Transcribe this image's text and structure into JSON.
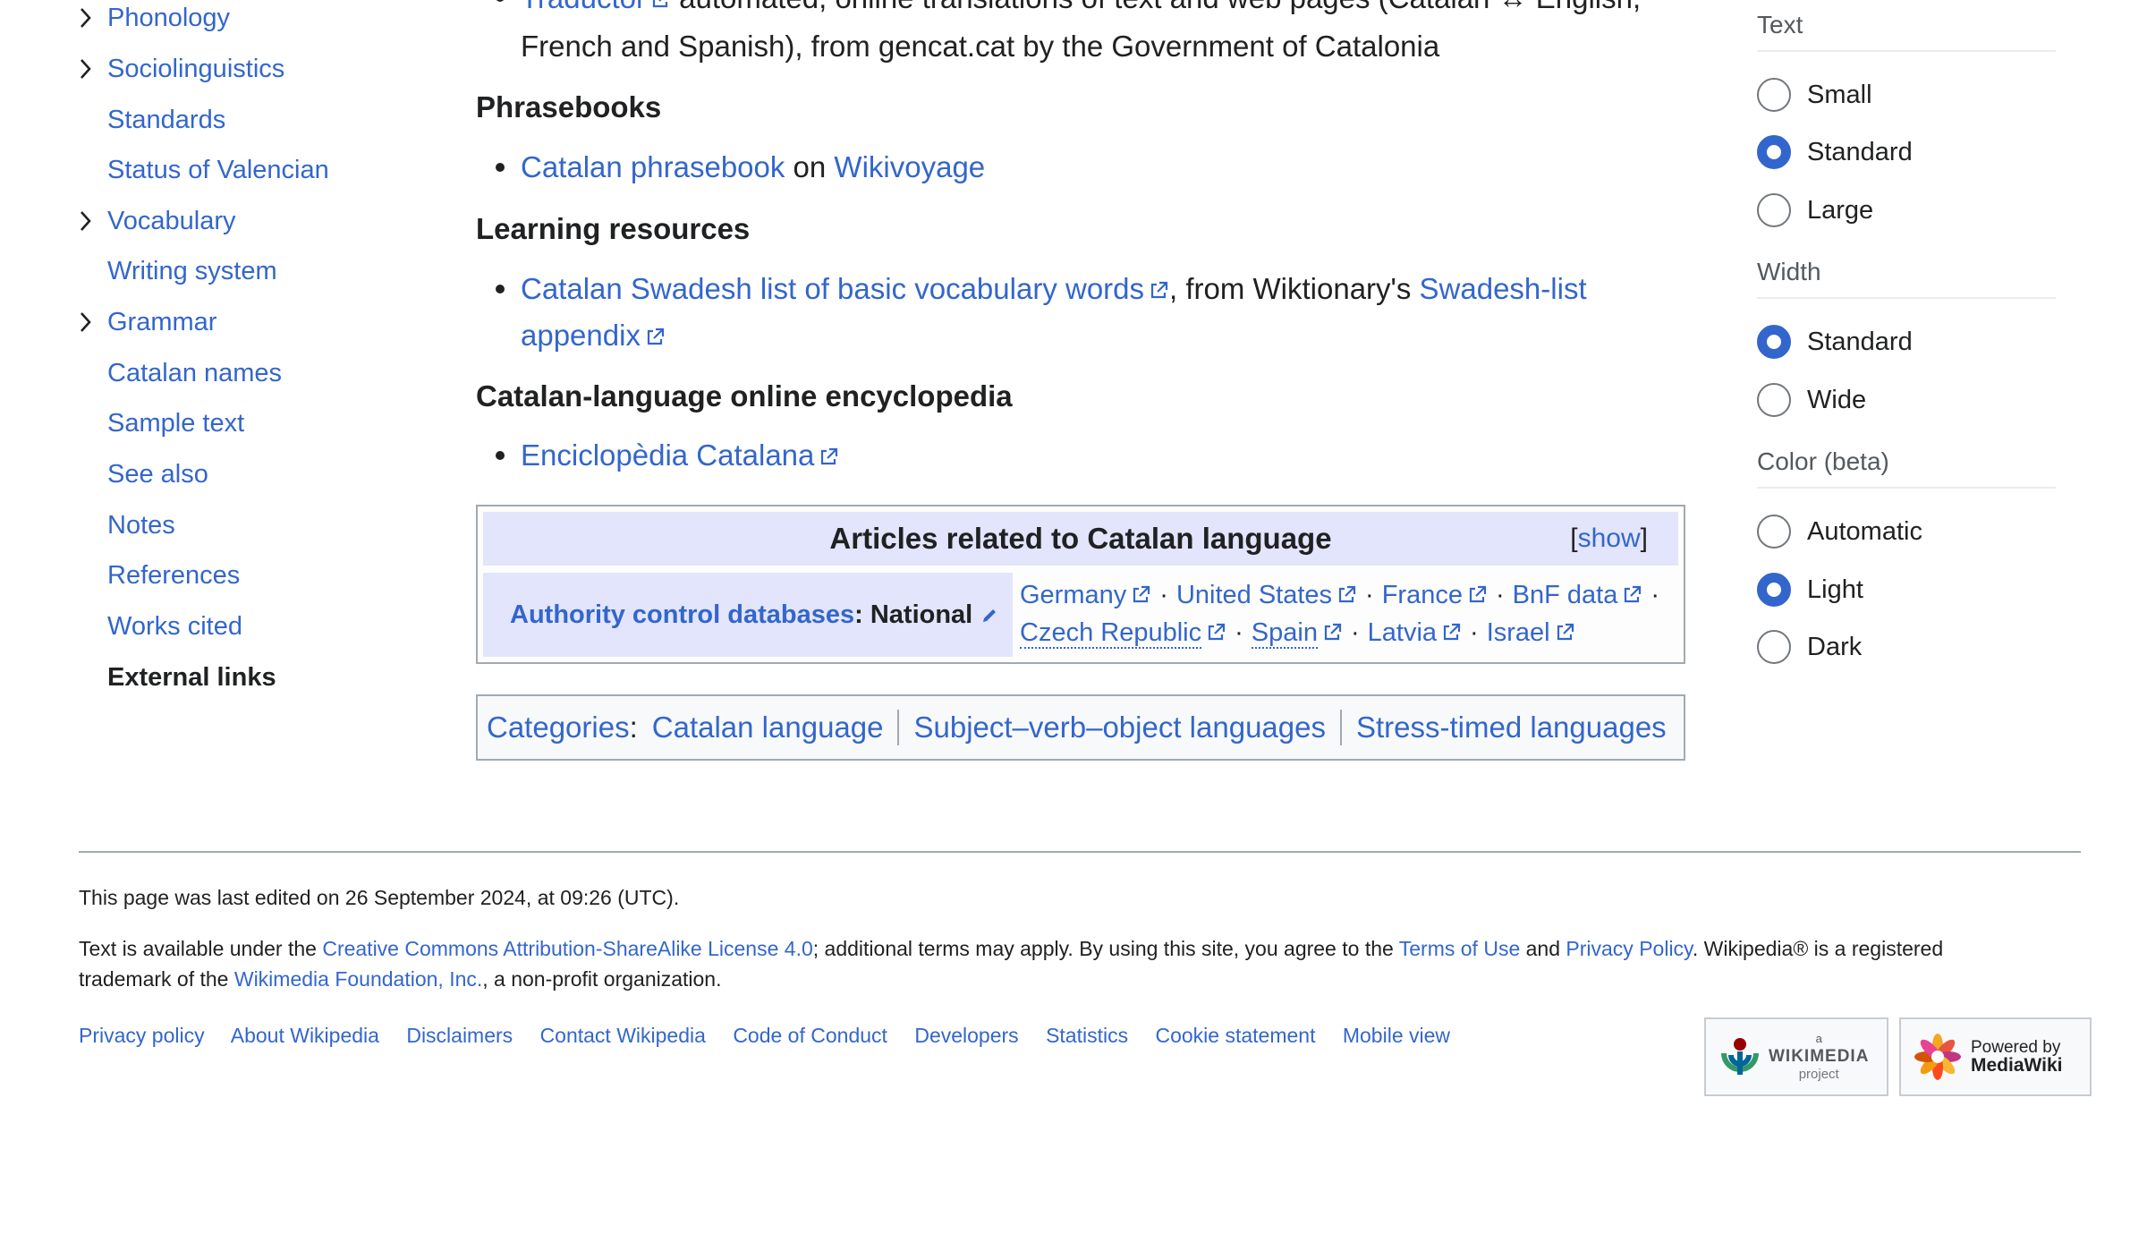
{
  "toc": {
    "items": [
      {
        "label": "Phonology",
        "expandable": true
      },
      {
        "label": "Sociolinguistics",
        "expandable": true
      },
      {
        "label": "Standards",
        "expandable": false
      },
      {
        "label": "Status of Valencian",
        "expandable": false
      },
      {
        "label": "Vocabulary",
        "expandable": true
      },
      {
        "label": "Writing system",
        "expandable": false
      },
      {
        "label": "Grammar",
        "expandable": true
      },
      {
        "label": "Catalan names",
        "expandable": false
      },
      {
        "label": "Sample text",
        "expandable": false
      },
      {
        "label": "See also",
        "expandable": false
      },
      {
        "label": "Notes",
        "expandable": false
      },
      {
        "label": "References",
        "expandable": false
      },
      {
        "label": "Works cited",
        "expandable": false
      },
      {
        "label": "External links",
        "expandable": false,
        "active": true
      }
    ]
  },
  "main": {
    "traductor": {
      "link": "Traductor",
      "line1_rest": " automated, online translations of text and web pages (Catalan ↔ English,",
      "line2": "French and Spanish), from gencat.cat by the Government of Catalonia"
    },
    "phrasebooks": {
      "heading": "Phrasebooks",
      "link1": "Catalan phrasebook",
      "mid": " on ",
      "link2": "Wikivoyage"
    },
    "learning": {
      "heading": "Learning resources",
      "link1": "Catalan Swadesh list of basic vocabulary words",
      "mid": ", from Wiktionary's ",
      "link2a": "Swadesh-list",
      "link2b": "appendix"
    },
    "encyclopedia": {
      "heading": "Catalan-language online encyclopedia",
      "link": "Enciclopèdia Catalana"
    },
    "navbox": {
      "title": "Articles related to Catalan language",
      "show_open": "[",
      "show": "show",
      "show_close": "]",
      "authority_link": "Authority control databases",
      "authority_rest": ": National",
      "row1": [
        "Germany",
        "United States",
        "France",
        "BnF data"
      ],
      "row2": [
        "Czech Republic",
        "Spain",
        "Latvia",
        "Israel"
      ],
      "separator": "·"
    },
    "categories": {
      "label": "Categories",
      "colon": ":",
      "items": [
        "Catalan language",
        "Subject–verb–object languages",
        "Stress-timed languages"
      ]
    }
  },
  "appearance": {
    "text": {
      "heading": "Text",
      "options": [
        "Small",
        "Standard",
        "Large"
      ],
      "selected": "Standard"
    },
    "width": {
      "heading": "Width",
      "options": [
        "Standard",
        "Wide"
      ],
      "selected": "Standard"
    },
    "color": {
      "heading": "Color (beta)",
      "options": [
        "Automatic",
        "Light",
        "Dark"
      ],
      "selected": "Light"
    }
  },
  "footer": {
    "last_edited": "This page was last edited on 26 September 2024, at 09:26 (UTC).",
    "license": {
      "p1": "Text is available under the ",
      "l1": "Creative Commons Attribution-ShareAlike License 4.0",
      "p2": "; additional terms may apply. By using this site, you agree to the ",
      "l2": "Terms of Use",
      "p3": " and ",
      "l3": "Privacy Policy",
      "p4": ". Wikipedia® is a registered",
      "p5": "trademark of the ",
      "l4": "Wikimedia Foundation, Inc.",
      "p6": ", a non-profit organization."
    },
    "links": [
      "Privacy policy",
      "About Wikipedia",
      "Disclaimers",
      "Contact Wikipedia",
      "Code of Conduct",
      "Developers",
      "Statistics",
      "Cookie statement",
      "Mobile view"
    ],
    "wikimedia_badge": {
      "small": "a",
      "name": "WIKIMEDIA",
      "sub": "project"
    },
    "mediawiki_badge": {
      "line1": "Powered by",
      "line2": "MediaWiki"
    }
  },
  "colors": {
    "link": "#3366cc",
    "navbox_header": "#e2e5fb",
    "border": "#a2a9b1",
    "text": "#202122"
  }
}
